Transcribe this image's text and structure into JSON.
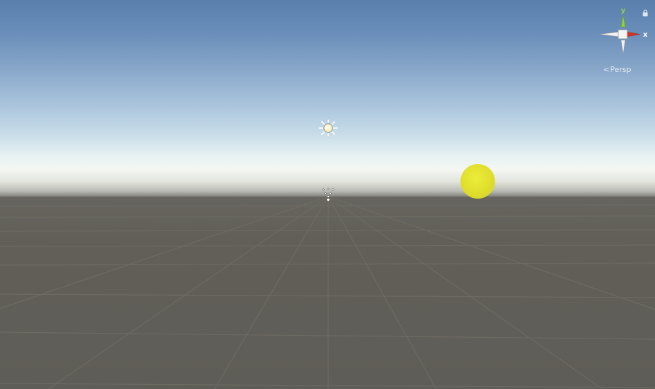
{
  "scene": {
    "sky_top_color": "#5a7fae",
    "horizon_color": "#f4f7f2",
    "ground_color": "#615f59",
    "grid_color": "#6e6c63"
  },
  "objects": {
    "sphere": {
      "name": "sphere",
      "color": "#e2e12f"
    },
    "directional_light": {
      "icon": "sun-icon"
    },
    "particle_system": {
      "icon": "particle-icon"
    }
  },
  "orientation_gizmo": {
    "y_label": "y",
    "x_label": "x",
    "y_color": "#8fd13a",
    "x_color": "#d9331f",
    "projection_label": "Persp",
    "projection_icon": "chevron-left-icon",
    "lock_icon": "lock-icon"
  }
}
